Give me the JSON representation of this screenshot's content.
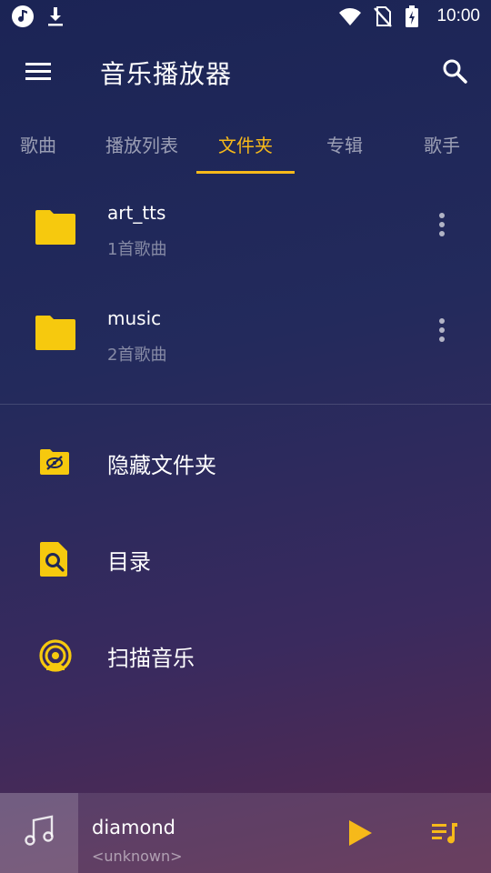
{
  "status_bar": {
    "time": "10:00",
    "left_icons": [
      "music-note-icon",
      "download-icon"
    ],
    "right_icons": [
      "wifi-icon",
      "no-sim-icon",
      "battery-charging-icon"
    ]
  },
  "app_bar": {
    "title": "音乐播放器",
    "menu_icon": "menu-icon",
    "search_icon": "search-icon"
  },
  "tabs": {
    "items": [
      {
        "label": "歌曲",
        "active": false
      },
      {
        "label": "播放列表",
        "active": false
      },
      {
        "label": "文件夹",
        "active": true
      },
      {
        "label": "专辑",
        "active": false
      },
      {
        "label": "歌手",
        "active": false
      }
    ]
  },
  "folders": [
    {
      "name": "art_tts",
      "count": "1首歌曲"
    },
    {
      "name": "music",
      "count": "2首歌曲"
    }
  ],
  "actions": [
    {
      "label": "隐藏文件夹",
      "icon": "hidden-folder-icon"
    },
    {
      "label": "目录",
      "icon": "directory-search-icon"
    },
    {
      "label": "扫描音乐",
      "icon": "scan-music-icon"
    }
  ],
  "player": {
    "title": "diamond",
    "artist": "<unknown>",
    "art_icon": "music-note-icon",
    "play_icon": "play-icon",
    "queue_icon": "queue-music-icon"
  },
  "colors": {
    "accent": "#f6b91a",
    "background_top": "#1b2455",
    "background_bottom": "#5a2a4e"
  }
}
